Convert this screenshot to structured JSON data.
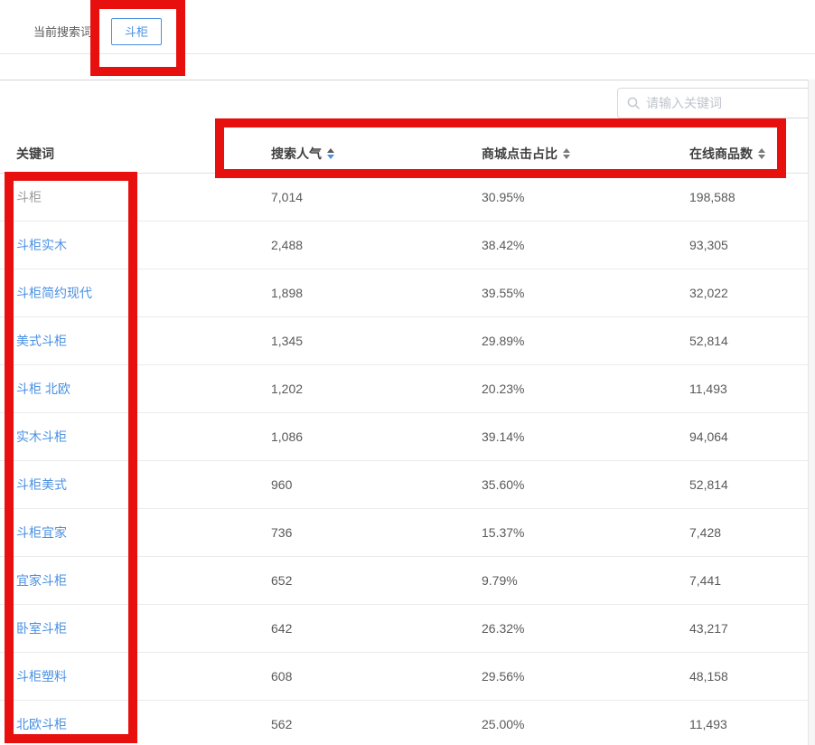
{
  "topbar": {
    "current_search_label": "当前搜索词：",
    "current_search_tag": "斗柜"
  },
  "search": {
    "placeholder": "请输入关键词",
    "icon": "search-icon"
  },
  "table": {
    "columns": [
      {
        "label": "关键词",
        "sortable": false,
        "sort": "none"
      },
      {
        "label": "搜索人气",
        "sortable": true,
        "sort": "desc"
      },
      {
        "label": "商城点击占比",
        "sortable": true,
        "sort": "none"
      },
      {
        "label": "在线商品数",
        "sortable": true,
        "sort": "none"
      }
    ],
    "rows": [
      {
        "keyword": "斗柜",
        "link": false,
        "search_popularity": "7,014",
        "mall_click_ratio": "30.95%",
        "online_products": "198,588"
      },
      {
        "keyword": "斗柜实木",
        "link": true,
        "search_popularity": "2,488",
        "mall_click_ratio": "38.42%",
        "online_products": "93,305"
      },
      {
        "keyword": "斗柜简约现代",
        "link": true,
        "search_popularity": "1,898",
        "mall_click_ratio": "39.55%",
        "online_products": "32,022"
      },
      {
        "keyword": "美式斗柜",
        "link": true,
        "search_popularity": "1,345",
        "mall_click_ratio": "29.89%",
        "online_products": "52,814"
      },
      {
        "keyword": "斗柜 北欧",
        "link": true,
        "search_popularity": "1,202",
        "mall_click_ratio": "20.23%",
        "online_products": "11,493"
      },
      {
        "keyword": "实木斗柜",
        "link": true,
        "search_popularity": "1,086",
        "mall_click_ratio": "39.14%",
        "online_products": "94,064"
      },
      {
        "keyword": "斗柜美式",
        "link": true,
        "search_popularity": "960",
        "mall_click_ratio": "35.60%",
        "online_products": "52,814"
      },
      {
        "keyword": "斗柜宜家",
        "link": true,
        "search_popularity": "736",
        "mall_click_ratio": "15.37%",
        "online_products": "7,428"
      },
      {
        "keyword": "宜家斗柜",
        "link": true,
        "search_popularity": "652",
        "mall_click_ratio": "9.79%",
        "online_products": "7,441"
      },
      {
        "keyword": "卧室斗柜",
        "link": true,
        "search_popularity": "642",
        "mall_click_ratio": "26.32%",
        "online_products": "43,217"
      },
      {
        "keyword": "斗柜塑料",
        "link": true,
        "search_popularity": "608",
        "mall_click_ratio": "29.56%",
        "online_products": "48,158"
      },
      {
        "keyword": "北欧斗柜",
        "link": true,
        "search_popularity": "562",
        "mall_click_ratio": "25.00%",
        "online_products": "11,493"
      }
    ]
  },
  "colors": {
    "link_blue": "#4a90e2",
    "tag_border_blue": "#4a90e2",
    "sort_active_blue": "#4a90e2",
    "sort_inactive_gray": "#7a7a7a",
    "header_text": "#404040",
    "cell_text": "#595959",
    "muted_keyword": "#9b9b9b",
    "row_divider": "#ebebeb",
    "annotation_red": "#e8100e"
  }
}
